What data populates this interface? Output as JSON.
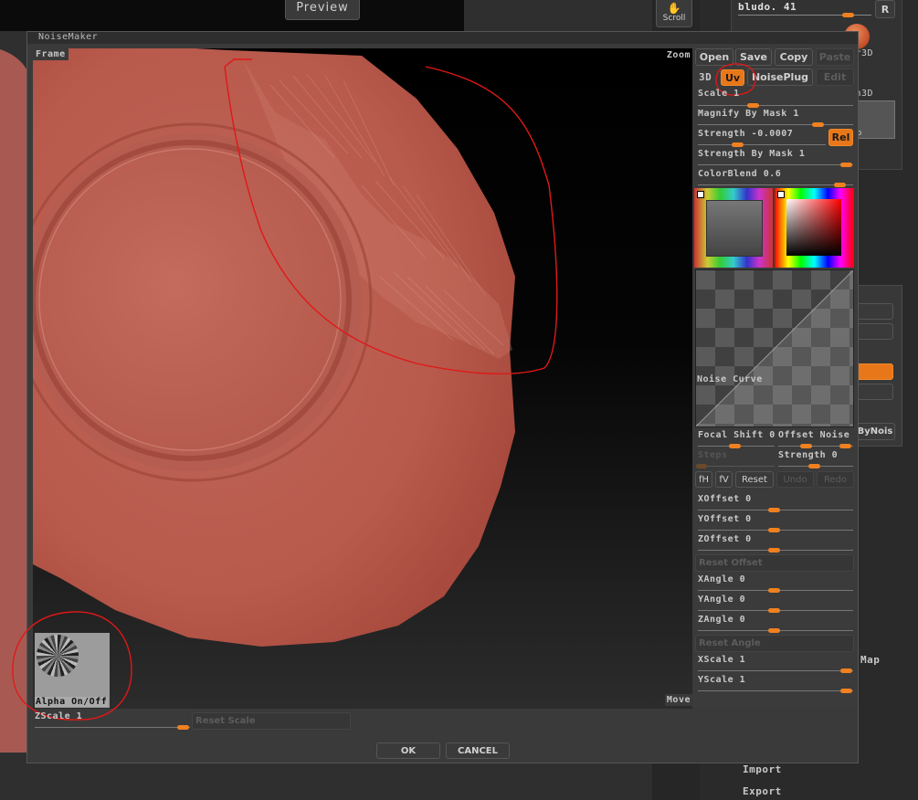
{
  "app": {
    "window_title": "NoiseMaker",
    "preview_button": "Preview"
  },
  "right_bg": {
    "scroll_label": "Scroll",
    "r_button": "R",
    "brush_label": "bludo. 41",
    "frag1": "er3D",
    "frag2": "sh3D",
    "frag3": "o",
    "bynoise_label": "ByNois",
    "map_label": "Map",
    "import_label": "Import",
    "export_label": "Export"
  },
  "canvas": {
    "frame_label": "Frame",
    "zoom_label": "Zoom",
    "move_label": "Move",
    "alpha_label": "Alpha On/Off"
  },
  "toolbar": {
    "open": "Open",
    "save": "Save",
    "copy": "Copy",
    "paste": "Paste",
    "mode_3d": "3D",
    "uv": "Uv",
    "noiseplug": "NoisePlug",
    "edit": "Edit"
  },
  "sliders": {
    "scale": "Scale 1",
    "magnify": "Magnify By Mask 1",
    "strength": "Strength -0.0007",
    "rel": "Rel",
    "strength_mask": "Strength By Mask 1",
    "colorblend": "ColorBlend 0.6",
    "noise_curve": "Noise Curve",
    "focal_shift": "Focal Shift 0",
    "offset_noise": "Offset Noise",
    "steps": "Steps",
    "strength0": "Strength 0",
    "fh": "fH",
    "fv": "fV",
    "reset": "Reset",
    "undo": "Undo",
    "redo": "Redo",
    "xoffset": "XOffset 0",
    "yoffset": "YOffset 0",
    "zoffset": "ZOffset 0",
    "reset_offset": "Reset Offset",
    "xangle": "XAngle 0",
    "yangle": "YAngle 0",
    "zangle": "ZAngle 0",
    "reset_angle": "Reset Angle",
    "xscale": "XScale 1",
    "yscale": "YScale 1",
    "zscale": "ZScale 1",
    "reset_scale": "Reset Scale"
  },
  "dialog": {
    "ok": "OK",
    "cancel": "CANCEL"
  },
  "colors": {
    "accent": "#f08020",
    "annotation": "#e01818",
    "mesh": "#b5574a"
  }
}
